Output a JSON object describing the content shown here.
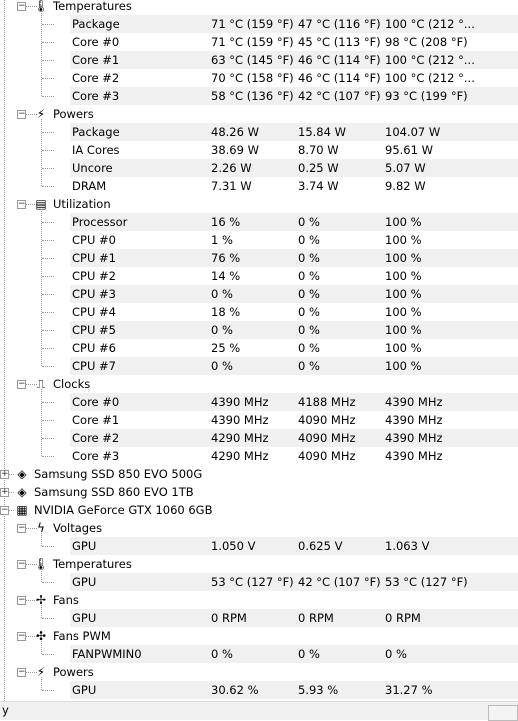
{
  "tree": [
    {
      "kind": "cat",
      "label": "Temperatures",
      "icon": "thermometer-icon",
      "indent": 1,
      "children": [
        [
          "Package",
          "71 °C  (159 °F)",
          "47 °C  (116 °F)",
          "100 °C  (212 °..."
        ],
        [
          "Core #0",
          "71 °C  (159 °F)",
          "45 °C  (113 °F)",
          "98 °C  (208 °F)"
        ],
        [
          "Core #1",
          "63 °C  (145 °F)",
          "46 °C  (114 °F)",
          "100 °C  (212 °..."
        ],
        [
          "Core #2",
          "70 °C  (158 °F)",
          "46 °C  (114 °F)",
          "100 °C  (212 °..."
        ],
        [
          "Core #3",
          "58 °C  (136 °F)",
          "42 °C  (107 °F)",
          "93 °C  (199 °F)"
        ]
      ]
    },
    {
      "kind": "cat",
      "label": "Powers",
      "icon": "power-icon",
      "indent": 1,
      "children": [
        [
          "Package",
          "48.26 W",
          "15.84 W",
          "104.07 W"
        ],
        [
          "IA Cores",
          "38.69 W",
          "8.70 W",
          "95.61 W"
        ],
        [
          "Uncore",
          "2.26 W",
          "0.25 W",
          "5.07 W"
        ],
        [
          "DRAM",
          "7.31 W",
          "3.74 W",
          "9.82 W"
        ]
      ]
    },
    {
      "kind": "cat",
      "label": "Utilization",
      "icon": "utilization-icon",
      "indent": 1,
      "children": [
        [
          "Processor",
          "16 %",
          "0 %",
          "100 %"
        ],
        [
          "CPU #0",
          "1 %",
          "0 %",
          "100 %"
        ],
        [
          "CPU #1",
          "76 %",
          "0 %",
          "100 %"
        ],
        [
          "CPU #2",
          "14 %",
          "0 %",
          "100 %"
        ],
        [
          "CPU #3",
          "0 %",
          "0 %",
          "100 %"
        ],
        [
          "CPU #4",
          "18 %",
          "0 %",
          "100 %"
        ],
        [
          "CPU #5",
          "0 %",
          "0 %",
          "100 %"
        ],
        [
          "CPU #6",
          "25 %",
          "0 %",
          "100 %"
        ],
        [
          "CPU #7",
          "0 %",
          "0 %",
          "100 %"
        ]
      ]
    },
    {
      "kind": "cat",
      "label": "Clocks",
      "icon": "clock-icon",
      "indent": 1,
      "children": [
        [
          "Core #0",
          "4390 MHz",
          "4188 MHz",
          "4390 MHz"
        ],
        [
          "Core #1",
          "4390 MHz",
          "4090 MHz",
          "4390 MHz"
        ],
        [
          "Core #2",
          "4290 MHz",
          "4090 MHz",
          "4390 MHz"
        ],
        [
          "Core #3",
          "4290 MHz",
          "4090 MHz",
          "4390 MHz"
        ]
      ]
    },
    {
      "kind": "dev",
      "label": "Samsung SSD 850 EVO 500G",
      "icon": "disk-icon",
      "expanded": false,
      "children": []
    },
    {
      "kind": "dev",
      "label": "Samsung SSD 860 EVO 1TB",
      "icon": "disk-icon",
      "expanded": false,
      "children": []
    },
    {
      "kind": "dev",
      "label": "NVIDIA GeForce GTX 1060 6GB",
      "icon": "gpu-icon",
      "expanded": true,
      "children": []
    },
    {
      "kind": "cat",
      "label": "Voltages",
      "icon": "voltage-icon",
      "indent": 1,
      "children": [
        [
          "GPU",
          "1.050 V",
          "0.625 V",
          "1.063 V"
        ]
      ]
    },
    {
      "kind": "cat",
      "label": "Temperatures",
      "icon": "thermometer-icon",
      "indent": 1,
      "children": [
        [
          "GPU",
          "53 °C  (127 °F)",
          "42 °C  (107 °F)",
          "53 °C  (127 °F)"
        ]
      ]
    },
    {
      "kind": "cat",
      "label": "Fans",
      "icon": "fan-icon",
      "indent": 1,
      "children": [
        [
          "GPU",
          "0 RPM",
          "0 RPM",
          "0 RPM"
        ]
      ]
    },
    {
      "kind": "cat",
      "label": "Fans PWM",
      "icon": "fan-pwm-icon",
      "indent": 1,
      "children": [
        [
          "FANPWMIN0",
          "0 %",
          "0 %",
          "0 %"
        ]
      ]
    },
    {
      "kind": "cat",
      "label": "Powers",
      "icon": "power-icon",
      "indent": 1,
      "children": [
        [
          "GPU",
          "30.62 %",
          "5.93 %",
          "31.27 %"
        ]
      ]
    }
  ],
  "icons": {
    "thermometer-icon": "🌡",
    "power-icon": "⚡",
    "utilization-icon": "▤",
    "clock-icon": "⎍",
    "disk-icon": "◈",
    "gpu-icon": "▦",
    "voltage-icon": "ϟ",
    "fan-icon": "✢",
    "fan-pwm-icon": "✣"
  },
  "colors": {
    "row_shade": "#f0f0f0",
    "tree_line": "#999999"
  },
  "status": {
    "text": "y"
  }
}
